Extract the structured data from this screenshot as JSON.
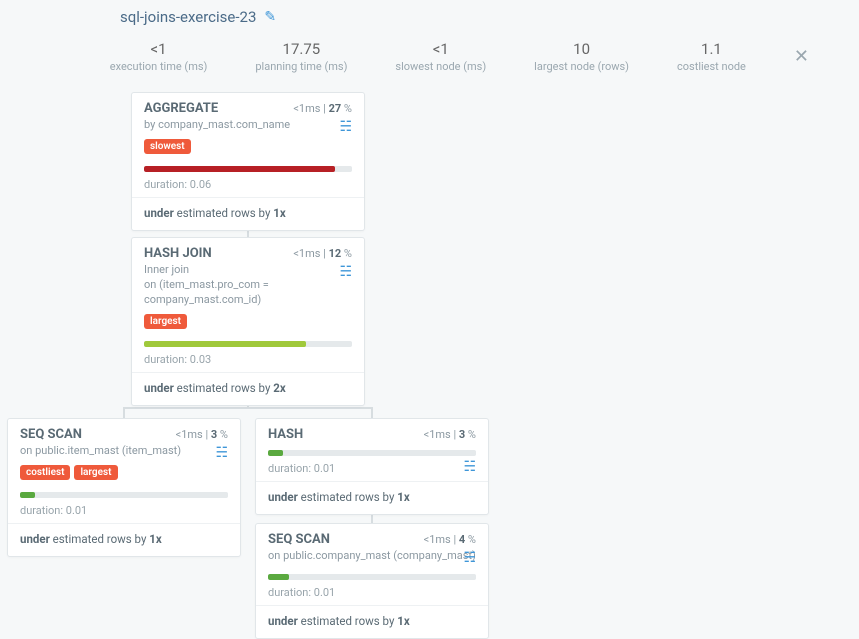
{
  "title": "sql-joins-exercise-23",
  "stats": {
    "execTime": {
      "value": "<1",
      "label": "execution time (ms)"
    },
    "planTime": {
      "value": "17.75",
      "label": "planning time (ms)"
    },
    "slowest": {
      "value": "<1",
      "label": "slowest node (ms)"
    },
    "largest": {
      "value": "10",
      "label": "largest node (rows)"
    },
    "costliest": {
      "value": "1.1",
      "label": "costliest node"
    }
  },
  "nodes": {
    "aggregate": {
      "title": "AGGREGATE",
      "meta_time": "<1",
      "meta_unit": "ms",
      "meta_pct": "27",
      "subPrefix": "by ",
      "subValue": "company_mast.com_name",
      "tags": [
        "slowest"
      ],
      "duration_prefix": "duration: ",
      "duration": "0.06",
      "est_prefix": "under",
      "est_mid": " estimated rows by ",
      "est_factor": "1x",
      "fill_color": "#b72025",
      "fill_width": "92%"
    },
    "hashjoin": {
      "title": "HASH JOIN",
      "meta_time": "<1",
      "meta_unit": "ms",
      "meta_pct": "12",
      "subLine1a": "Inner ",
      "subLine1b": "join",
      "subLine2": "on (item_mast.pro_com = company_mast.com_id)",
      "tags": [
        "largest"
      ],
      "duration_prefix": "duration: ",
      "duration": "0.03",
      "est_prefix": "under",
      "est_mid": " estimated rows by ",
      "est_factor": "2x",
      "fill_color": "#a0c93b",
      "fill_width": "78%"
    },
    "seqscan1": {
      "title": "SEQ SCAN",
      "meta_time": "<1",
      "meta_unit": "ms",
      "meta_pct": "3",
      "subPrefix": "on ",
      "subValue": "public.item_mast (item_mast)",
      "tags": [
        "costliest",
        "largest"
      ],
      "duration_prefix": "duration: ",
      "duration": "0.01",
      "est_prefix": "under",
      "est_mid": " estimated rows by ",
      "est_factor": "1x",
      "fill_color": "#5aa93f",
      "fill_width": "7%"
    },
    "hash": {
      "title": "HASH",
      "meta_time": "<1",
      "meta_unit": "ms",
      "meta_pct": "3",
      "duration_prefix": "duration: ",
      "duration": "0.01",
      "est_prefix": "under",
      "est_mid": " estimated rows by ",
      "est_factor": "1x",
      "fill_color": "#5aa93f",
      "fill_width": "7%"
    },
    "seqscan2": {
      "title": "SEQ SCAN",
      "meta_time": "<1",
      "meta_unit": "ms",
      "meta_pct": "4",
      "subPrefix": "on ",
      "subValue": "public.company_mast (company_mast)",
      "duration_prefix": "duration: ",
      "duration": "0.01",
      "est_prefix": "under",
      "est_mid": " estimated rows by ",
      "est_factor": "1x",
      "fill_color": "#5aa93f",
      "fill_width": "10%"
    }
  }
}
